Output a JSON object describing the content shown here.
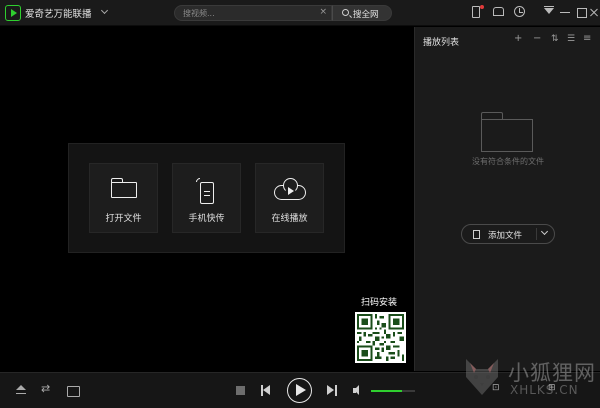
{
  "titlebar": {
    "app_title": "爱奇艺万能联播",
    "search_placeholder": "搜视频...",
    "search_clear": "×",
    "search_button": "搜全网",
    "icons": [
      "phone-icon",
      "skin-icon",
      "history-icon",
      "menu-icon",
      "minimize-icon",
      "maximize-icon",
      "close-icon"
    ]
  },
  "main": {
    "tiles": [
      {
        "label": "打开文件",
        "icon": "folder-icon"
      },
      {
        "label": "手机快传",
        "icon": "phone-transfer-icon"
      },
      {
        "label": "在线播放",
        "icon": "cloud-play-icon"
      }
    ],
    "qr_label": "扫码安装"
  },
  "playlist": {
    "title": "播放列表",
    "actions": {
      "add": "+",
      "remove": "−",
      "sort": "⇅",
      "list": "☰",
      "more": "≡"
    },
    "empty_text": "没有符合条件的文件",
    "add_file_label": "添加文件"
  },
  "controls": {
    "loop_glyph": "⇄",
    "volume_level": 0.7,
    "right_glyphs": [
      "⊡",
      "⊞"
    ]
  },
  "watermark": {
    "cn": "小狐狸网",
    "en": "XHLKS.CN"
  },
  "colors": {
    "accent": "#2fcf2f",
    "background": "#000000",
    "panel": "#1b1b1b"
  }
}
